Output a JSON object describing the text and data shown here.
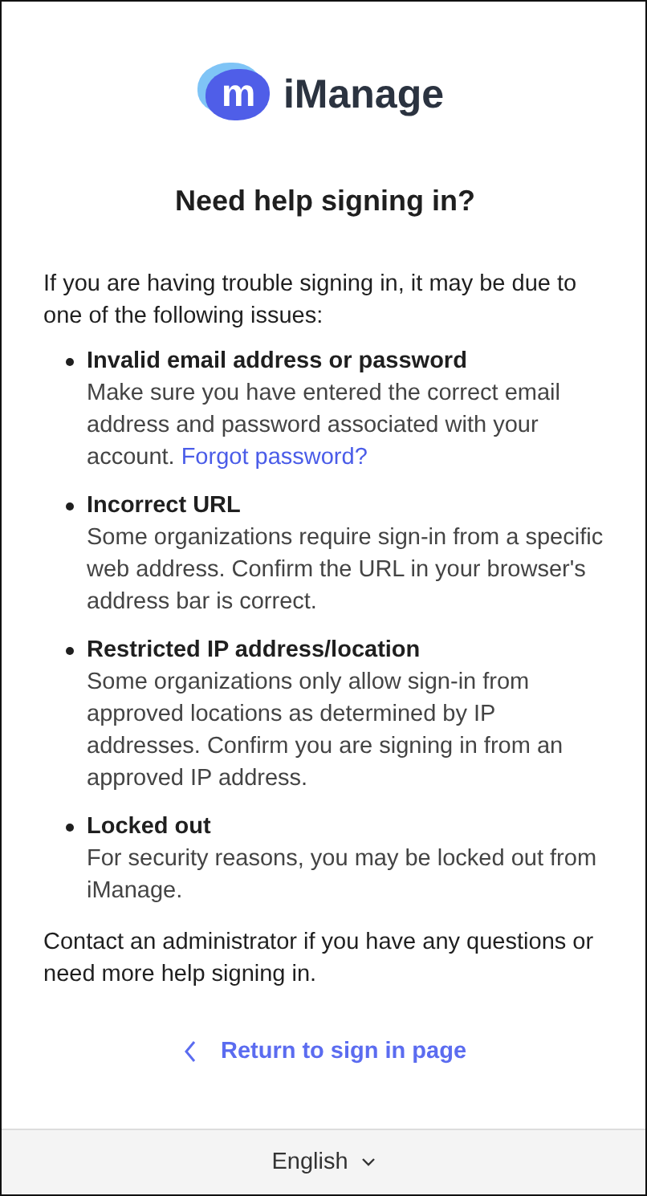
{
  "logo": {
    "mark": "m",
    "name": "iManage"
  },
  "heading": "Need help signing in?",
  "intro": "If you are having trouble signing in, it may be due to one of the following issues:",
  "issues": [
    {
      "title": "Invalid email address or password",
      "description": "Make sure you have entered the correct email address and password associated with your account.",
      "link": "Forgot password?"
    },
    {
      "title": "Incorrect URL",
      "description": "Some organizations require sign-in from a specific web address. Confirm the URL in your browser's address bar is correct."
    },
    {
      "title": "Restricted IP address/location",
      "description": "Some organizations only allow sign-in from approved locations as determined by IP addresses. Confirm you are signing in from an approved IP address."
    },
    {
      "title": "Locked out",
      "description": "For security reasons, you may be locked out from iManage."
    }
  ],
  "contact": "Contact an administrator if you have any questions or need more help signing in.",
  "return_link": "Return to sign in page",
  "language": "English"
}
